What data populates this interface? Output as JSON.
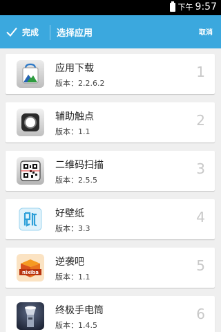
{
  "status_bar": {
    "ampm": "下午",
    "time": "9:57"
  },
  "action_bar": {
    "done_label": "完成",
    "title": "选择应用",
    "cancel_label": "取消"
  },
  "apps": [
    {
      "name": "应用下载",
      "version": "版本：2.2.6.2",
      "index": "1",
      "icon": "app-store-bag-icon"
    },
    {
      "name": "辅助触点",
      "version": "版本：1.1",
      "index": "2",
      "icon": "assistive-touch-icon"
    },
    {
      "name": "二维码扫描",
      "version": "版本：2.5.5",
      "index": "3",
      "icon": "qr-scanner-icon"
    },
    {
      "name": "好壁纸",
      "version": "版本：3.3",
      "index": "4",
      "icon": "wallpaper-icon"
    },
    {
      "name": "逆袭吧",
      "version": "版本：1.1",
      "index": "5",
      "icon": "nixiba-box-icon",
      "icon_text": "nixiba"
    },
    {
      "name": "终极手电筒",
      "version": "版本：1.4.5",
      "index": "6",
      "icon": "flashlight-icon"
    }
  ],
  "colors": {
    "accent": "#3ba8de",
    "background": "#efefef"
  }
}
